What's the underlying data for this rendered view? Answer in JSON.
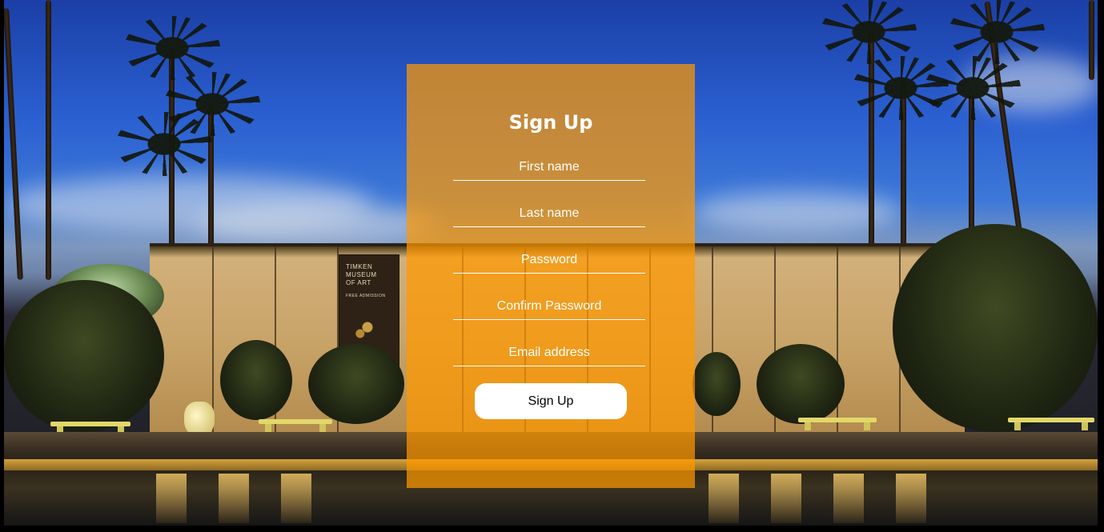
{
  "signup": {
    "title": "Sign Up",
    "fields": {
      "first_name": {
        "placeholder": "First name",
        "value": ""
      },
      "last_name": {
        "placeholder": "Last name",
        "value": ""
      },
      "password": {
        "placeholder": "Password",
        "value": ""
      },
      "confirm_password": {
        "placeholder": "Confirm Password",
        "value": ""
      },
      "email": {
        "placeholder": "Email address",
        "value": ""
      }
    },
    "submit_label": "Sign Up"
  },
  "background": {
    "banner_text": "TIMKEN\nMUSEUM\nOF ART",
    "banner_subtext": "FREE ADMISSION"
  },
  "colors": {
    "panel_overlay": "#ff9900",
    "button_bg": "#ffffff",
    "text": "#ffffff"
  }
}
